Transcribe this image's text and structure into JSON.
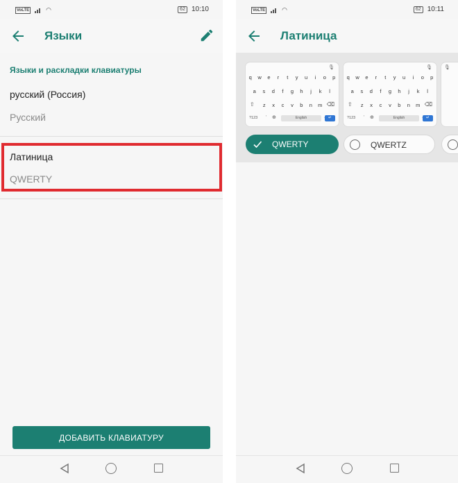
{
  "left": {
    "status": {
      "volte": "VoLTE",
      "battery": "62",
      "time": "10:10"
    },
    "title": "Языки",
    "section_header": "Языки и раскладки клавиатуры",
    "items": [
      {
        "title": "русский (Россия)",
        "subtitle": "Русский"
      },
      {
        "title": "Латиница",
        "subtitle": "QWERTY"
      }
    ],
    "add_button": "ДОБАВИТЬ КЛАВИАТУРУ"
  },
  "right": {
    "status": {
      "volte": "VoLTE",
      "battery": "62",
      "time": "10:11"
    },
    "title": "Латиница",
    "keyboard_rows": [
      [
        "q",
        "w",
        "e",
        "r",
        "t",
        "y",
        "u",
        "i",
        "o",
        "p"
      ],
      [
        "a",
        "s",
        "d",
        "f",
        "g",
        "h",
        "j",
        "k",
        "l"
      ],
      [
        "z",
        "x",
        "c",
        "v",
        "b",
        "n",
        "m"
      ]
    ],
    "keyboard_bottom": {
      "numbers": "?123",
      "space": "English"
    },
    "layouts": [
      {
        "label": "QWERTY",
        "selected": true
      },
      {
        "label": "QWERTZ",
        "selected": false
      }
    ]
  },
  "colors": {
    "accent": "#1c7f72",
    "highlight": "#e02b30",
    "enter_key": "#2f76d4"
  },
  "icons": [
    "back-arrow-icon",
    "pencil-icon",
    "check-icon",
    "mic-icon",
    "shift-icon",
    "backspace-icon",
    "globe-icon",
    "enter-icon",
    "nav-back-icon",
    "nav-home-icon",
    "nav-recent-icon"
  ]
}
